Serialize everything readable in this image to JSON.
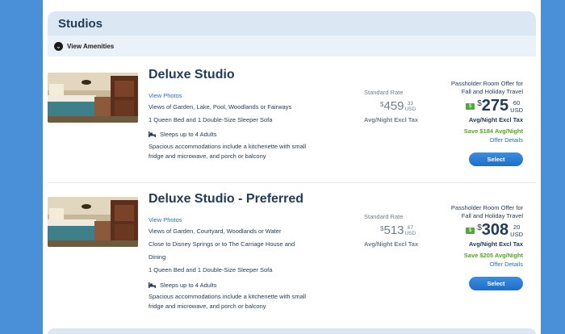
{
  "section": {
    "title": "Studios",
    "amenities_label": "View Amenities"
  },
  "rooms": [
    {
      "name": "Deluxe Studio",
      "photos_label": "View Photos",
      "lines": [
        "Views of Garden, Lake, Pool, Woodlands or Fairways",
        "1 Queen Bed and 1 Double-Size Sleeper Sofa"
      ],
      "sleeps": "Sleeps up to 4 Adults",
      "description": [
        "Spacious accommodations include a kitchenette with small",
        "fridge and microwave, and porch or balcony"
      ],
      "standard": {
        "label": "Standard Rate",
        "dollar": "$",
        "whole": "459",
        "cents": "33",
        "currency": "USD",
        "sub": "Avg/Night Excl Tax"
      },
      "offer": {
        "title_1": "Passholder Room Offer for",
        "title_2": "Fall and Holiday Travel",
        "dollar": "$",
        "whole": "275",
        "cents": "60",
        "currency": "USD",
        "sub": "Avg/Night Excl Tax",
        "save": "Save $184 Avg/Night",
        "details": "Offer Details"
      },
      "select_label": "Select"
    },
    {
      "name": "Deluxe Studio - Preferred",
      "photos_label": "View Photos",
      "lines": [
        "Views of Garden, Courtyard, Woodlands or Water",
        "Close to Disney Springs or to The Carriage House and",
        "Dining",
        "1 Queen Bed and 1 Double-Size Sleeper Sofa"
      ],
      "sleeps": "Sleeps up to 4 Adults",
      "description": [
        "Spacious accommodations include a kitchenette with small",
        "fridge and microwave, and porch or balcony"
      ],
      "standard": {
        "label": "Standard Rate",
        "dollar": "$",
        "whole": "513",
        "cents": "67",
        "currency": "USD",
        "sub": "Avg/Night Excl Tax"
      },
      "offer": {
        "title_1": "Passholder Room Offer for",
        "title_2": "Fall and Holiday Travel",
        "dollar": "$",
        "whole": "308",
        "cents": "20",
        "currency": "USD",
        "sub": "Avg/Night Excl Tax",
        "save": "Save $205 Avg/Night",
        "details": "Offer Details"
      },
      "select_label": "Select"
    }
  ],
  "icons": {
    "amenities": "chevron-down-icon",
    "sleeps": "bed-icon",
    "offer_tag": "tag-icon"
  },
  "colors": {
    "background": "#4a90d9",
    "header": "#dbe8f4",
    "link": "#2a6fc4",
    "save": "#5aa12f",
    "button": "#1f6ec7"
  }
}
